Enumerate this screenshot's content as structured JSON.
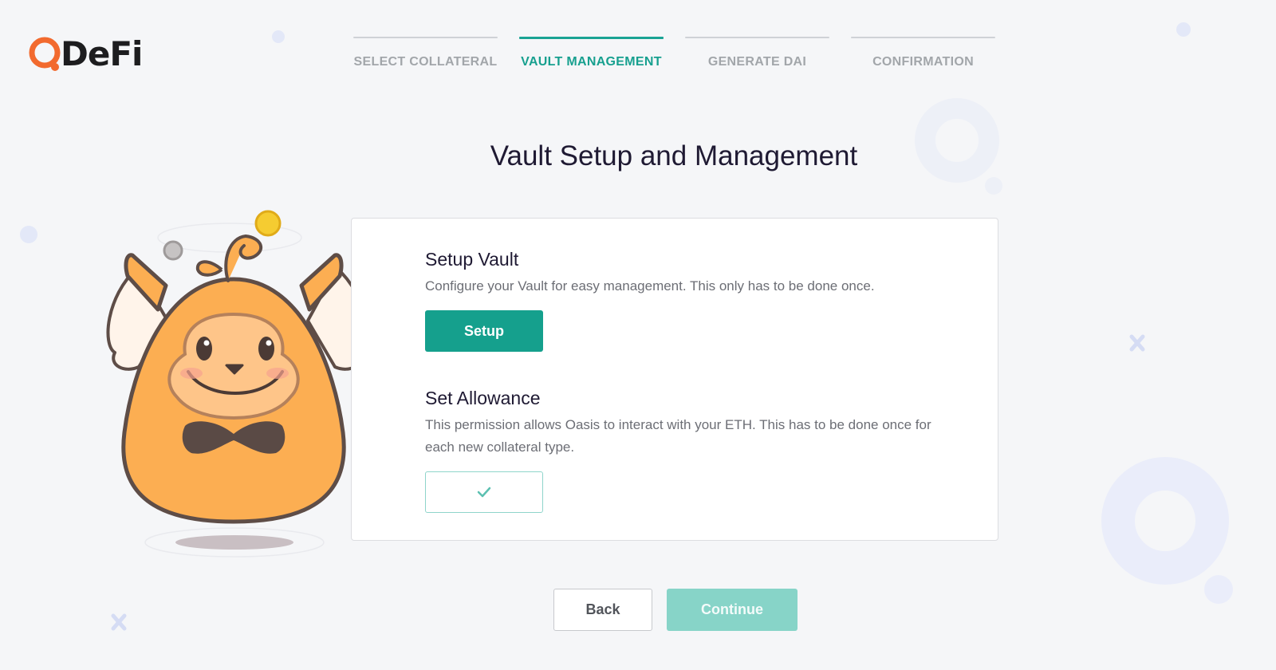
{
  "brand": {
    "name": "DeFi",
    "accent": "#f26a2e"
  },
  "steps": [
    {
      "label": "SELECT COLLATERAL",
      "active": false
    },
    {
      "label": "VAULT MANAGEMENT",
      "active": true
    },
    {
      "label": "GENERATE DAI",
      "active": false
    },
    {
      "label": "CONFIRMATION",
      "active": false
    }
  ],
  "page": {
    "title": "Vault Setup and Management"
  },
  "setup_vault": {
    "title": "Setup Vault",
    "description": "Configure your Vault for easy management. This only has to be done once.",
    "button_label": "Setup"
  },
  "set_allowance": {
    "title": "Set Allowance",
    "description": "This permission allows Oasis to interact with your ETH. This has to be done once for each new collateral type.",
    "button_icon": "checkmark-icon",
    "status": "done"
  },
  "footer": {
    "back_label": "Back",
    "continue_label": "Continue"
  },
  "colors": {
    "primary": "#15a08d",
    "primary_disabled": "#87d4c8",
    "active_step": "#17a08f",
    "inactive_step": "#a2a6aa",
    "mascot": "#fcae52"
  }
}
